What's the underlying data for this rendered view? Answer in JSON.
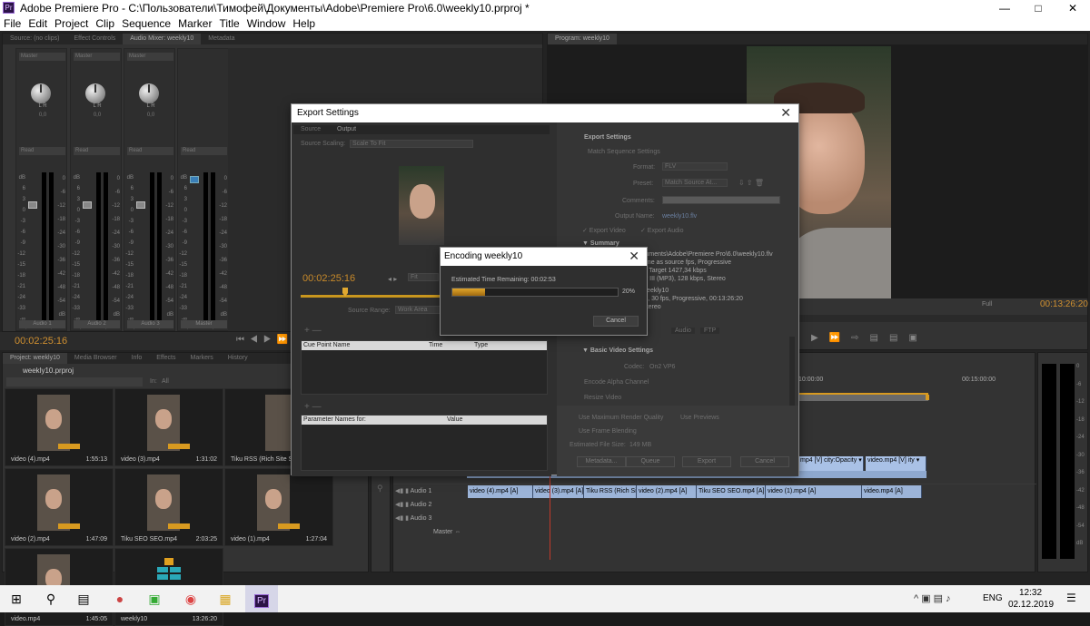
{
  "window": {
    "title": "Adobe Premiere Pro - C:\\Пользователи\\Тимофей\\Документы\\Adobe\\Premiere Pro\\6.0\\weekly10.prproj *"
  },
  "menu": [
    "File",
    "Edit",
    "Project",
    "Clip",
    "Sequence",
    "Marker",
    "Title",
    "Window",
    "Help"
  ],
  "top_left_panel": {
    "tabs": [
      "Source: (no clips)",
      "Effect Controls",
      "Audio Mixer: weekly10",
      "Metadata"
    ],
    "strips": [
      {
        "mode": "Master",
        "automation": "Read",
        "pan": "0,0",
        "lr": "L  R",
        "name": "Audio 1",
        "readout_l": "0,0",
        "readout_r": "-2,8"
      },
      {
        "mode": "Master",
        "automation": "Read",
        "pan": "0,0",
        "lr": "L  R",
        "name": "Audio 2",
        "readout_l": "0,0",
        "readout_r": "-2,8"
      },
      {
        "mode": "Master",
        "automation": "Read",
        "pan": "0,0",
        "lr": "L  R",
        "name": "Audio 3",
        "readout_l": "0,0",
        "readout_r": "-2,8"
      },
      {
        "mode": "",
        "automation": "Read",
        "pan": "",
        "lr": "",
        "name": "Master",
        "readout_l": "0,0",
        "readout_r": "-2,8"
      }
    ],
    "db_scale": [
      "dB",
      "6",
      "3",
      "0",
      "-3",
      "-6",
      "-9",
      "-12",
      "-15",
      "-18",
      "-21",
      "-24",
      "-33",
      "-∞"
    ],
    "meter_scale": [
      "0",
      "-6",
      "-12",
      "-18",
      "-24",
      "-30",
      "-36",
      "-42",
      "-48",
      "-54",
      "dB"
    ],
    "timecode": "00:02:25:16"
  },
  "program_panel": {
    "tab": "Program: weekly10",
    "fit": "Full",
    "timecode": "00:13:26:20"
  },
  "project_panel": {
    "tabs": [
      "Project: weekly10",
      "Media Browser",
      "Info",
      "Effects",
      "Markers",
      "History"
    ],
    "project_name": "weekly10.prproj",
    "in_label": "In:",
    "in_value": "All",
    "items": [
      {
        "name": "video (4).mp4",
        "duration": "1:55:13"
      },
      {
        "name": "video (3).mp4",
        "duration": "1:31:02"
      },
      {
        "name": "Tiku RSS (Rich Site Sum",
        "duration": ""
      },
      {
        "name": "video (2).mp4",
        "duration": "1:47:09"
      },
      {
        "name": "Tiku SEO SEO.mp4",
        "duration": "2:03:25"
      },
      {
        "name": "video (1).mp4",
        "duration": "1:27:04"
      },
      {
        "name": "video.mp4",
        "duration": "1:45:05"
      },
      {
        "name": "weekly10",
        "duration": "13:26:20"
      }
    ]
  },
  "timeline": {
    "ruler": [
      "10:00:00",
      "00:15:00:00"
    ],
    "video_clips": [
      "mp4 [V]",
      "city:Opacity ▾",
      "video.mp4 [V]",
      "ity ▾"
    ],
    "audio_tracks": [
      "Audio 1",
      "Audio 2",
      "Audio 3",
      "Master"
    ],
    "audio_clips": [
      "video (4).mp4 [A]",
      "video (3).mp4 [A]",
      "Tiku RSS (Rich Sit",
      "video (2).mp4 [A]",
      "Tiku SEO SEO.mp4 [A]",
      "video (1).mp4 [A]",
      "video.mp4 [A]"
    ]
  },
  "right_meter": {
    "scale": [
      "0",
      "-6",
      "-12",
      "-18",
      "-24",
      "-30",
      "-36",
      "-42",
      "-48",
      "-54",
      "dB"
    ]
  },
  "export_dialog": {
    "title": "Export Settings",
    "tabs": [
      "Source",
      "Output"
    ],
    "source_scaling_label": "Source Scaling:",
    "source_scaling_value": "Scale To Fit",
    "timecode": "00:02:25:16",
    "fit": "Fit",
    "source_range_label": "Source Range:",
    "source_range_value": "Work Area",
    "cue_columns": [
      "Cue Point Name",
      "Time",
      "Type"
    ],
    "param_columns": [
      "Parameter Names for:",
      "Value"
    ],
    "settings_header": "Export Settings",
    "match_sequence": "Match Sequence Settings",
    "format_label": "Format:",
    "format_value": "FLV",
    "preset_label": "Preset:",
    "preset_value": "Match Source At...",
    "comments_label": "Comments:",
    "output_name_label": "Output Name:",
    "output_name_value": "weekly10.flv",
    "export_video": "✓ Export Video",
    "export_audio": "✓ Export Audio",
    "summary_header": "Summary",
    "summary_lines": [
      "cuments\\Adobe\\Premiere Pro\\6.0\\weekly10.flv",
      "ame as source fps, Progressive",
      "s, Target 1427,34 kbps",
      "er III (MP3), 128 kbps, Stereo"
    ],
    "summary_lines2": [
      "weekly10",
      "0), 30 fps, Progressive, 00:13:26:20",
      "Stereo"
    ],
    "out_tabs": [
      "Audio",
      "FTP"
    ],
    "basic_video_header": "Basic Video Settings",
    "codec_label": "Codec:",
    "codec_value": "On2 VP6",
    "encode_alpha": "Encode Alpha Channel",
    "resize_video": "Resize Video",
    "max_render": "Use Maximum Render Quality",
    "use_previews": "Use Previews",
    "frame_blending": "Use Frame Blending",
    "file_size_label": "Estimated File Size:",
    "file_size_value": "149 MB",
    "buttons": [
      "Metadata...",
      "Queue",
      "Export",
      "Cancel"
    ]
  },
  "encoding_dialog": {
    "title": "Encoding weekly10",
    "time_remaining_label": "Estimated Time Remaining:",
    "time_remaining_value": "00:02:53",
    "progress": 0.2,
    "progress_label": "20%",
    "cancel_label": "Cancel"
  },
  "taskbar": {
    "lang": "ENG",
    "time": "12:32",
    "date": "02.12.2019",
    "app_icons": [
      "windows-logo",
      "search",
      "task-view",
      "color-app",
      "green-app",
      "chrome",
      "file-explorer",
      "premiere-pro"
    ]
  }
}
